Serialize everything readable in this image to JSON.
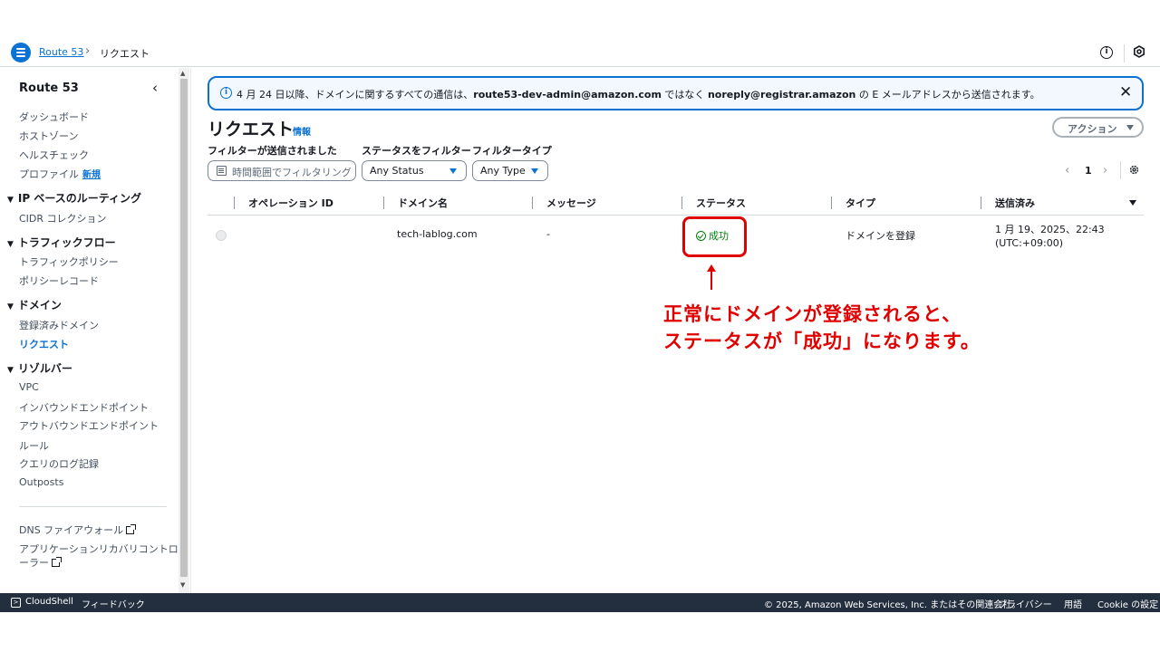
{
  "breadcrumb": {
    "service": "Route 53",
    "current": "リクエスト"
  },
  "sidebar": {
    "title": "Route 53",
    "items_top": [
      "ダッシュボード",
      "ホストゾーン",
      "ヘルスチェック",
      "プロファイル"
    ],
    "new_badge": "新規",
    "sections": [
      {
        "label": "IP ベースのルーティング",
        "items": [
          "CIDR コレクション"
        ]
      },
      {
        "label": "トラフィックフロー",
        "items": [
          "トラフィックポリシー",
          "ポリシーレコード"
        ]
      },
      {
        "label": "ドメイン",
        "items": [
          "登録済みドメイン",
          "リクエスト"
        ]
      },
      {
        "label": "リゾルバー",
        "items": [
          "VPC",
          "インバウンドエンドポイント",
          "アウトバウンドエンドポイント",
          "ルール",
          "クエリのログ記録",
          "Outposts"
        ]
      }
    ],
    "external": [
      "DNS ファイアウォール",
      "アプリケーションリカバリコントロ",
      "ーラー"
    ]
  },
  "flash": {
    "text_prefix": "4 月 24 日以降、ドメインに関するすべての通信は、",
    "from_address": "route53-dev-admin@amazon.com",
    "text_mid": " ではなく ",
    "to_address": "noreply@registrar.amazon",
    "text_suffix": " の E メールアドレスから送信されます。"
  },
  "page": {
    "title": "リクエスト",
    "info": "情報",
    "action": "アクション"
  },
  "filters": {
    "date_label": "フィルターが送信されました",
    "date_placeholder": "時間範囲でフィルタリング",
    "status_label": "ステータスをフィルター",
    "status_value": "Any Status",
    "type_label": "フィルタータイプ",
    "type_value": "Any Type"
  },
  "pagination": {
    "page": "1"
  },
  "table": {
    "columns": [
      "オペレーション ID",
      "ドメイン名",
      "メッセージ",
      "ステータス",
      "タイプ",
      "送信済み"
    ],
    "rows": [
      {
        "operation_id": "",
        "domain": "tech-lablog.com",
        "message": "-",
        "status": "成功",
        "type": "ドメインを登録",
        "sent_line1": "1 月 19、2025、22:43",
        "sent_line2": "(UTC:+09:00)"
      }
    ]
  },
  "annotation": {
    "line1": "正常にドメインが登録されると、",
    "line2": "ステータスが「成功」になります。"
  },
  "footer": {
    "cloudshell": "CloudShell",
    "feedback": "フィードバック",
    "copyright": "© 2025, Amazon Web Services, Inc. またはその関連会社。",
    "privacy": "プライバシー",
    "terms": "用語",
    "cookie": "Cookie の設定"
  },
  "colors": {
    "accent": "#0972d3",
    "success": "#037f0c",
    "annotation": "#e00000",
    "footer_bg": "#232f3e"
  }
}
